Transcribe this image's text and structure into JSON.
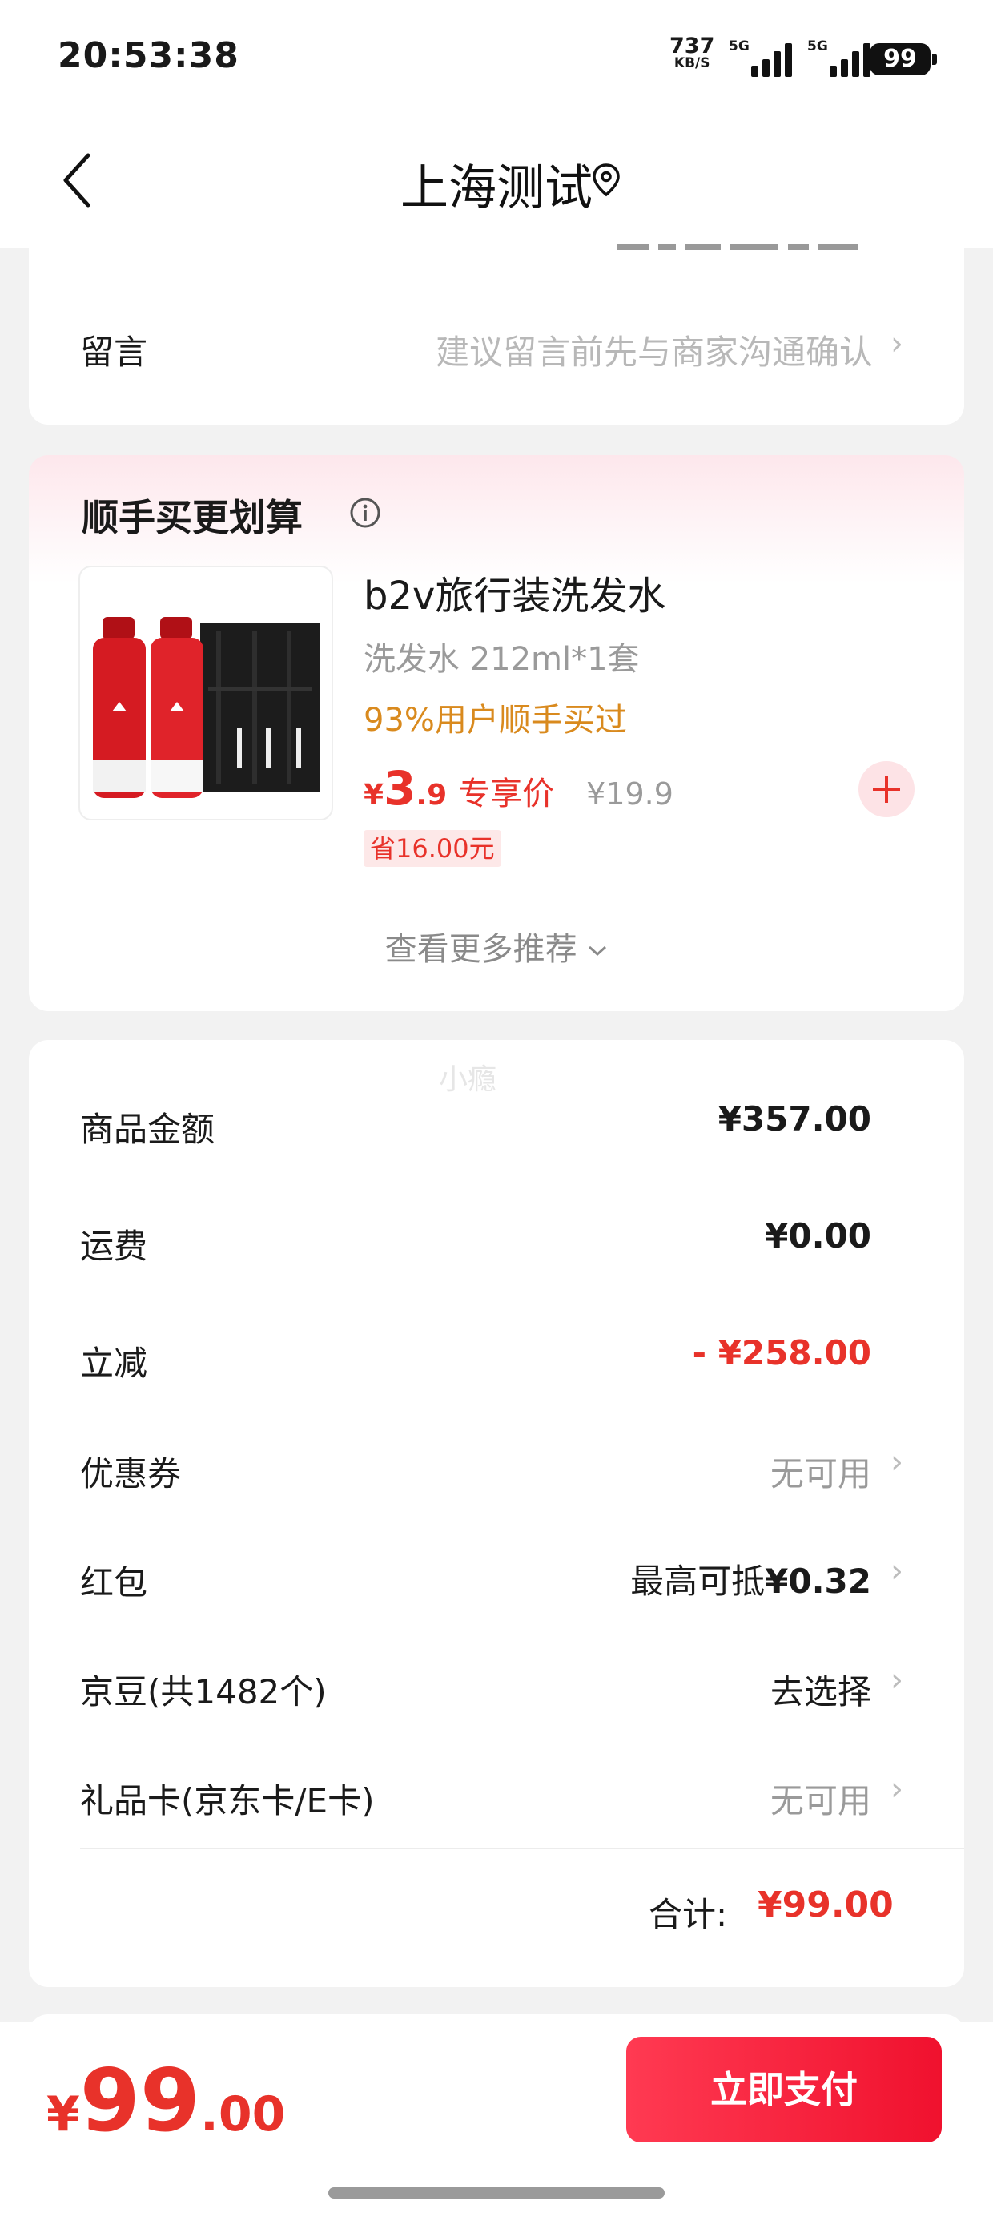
{
  "status_bar": {
    "time": "20:53:38",
    "net_speed": "737",
    "net_unit": "KB/S",
    "signal1": "5G",
    "signal2": "5G",
    "battery": "99"
  },
  "nav": {
    "title": "上海测试"
  },
  "message_row": {
    "label": "留言",
    "placeholder": "建议留言前先与商家沟通确认"
  },
  "recommend": {
    "title": "顺手买更划算",
    "product": {
      "name": "b2v旅行装洗发水",
      "spec": "洗发水 212ml*1套",
      "percent_text": "93%用户顺手买过",
      "price_symbol": "¥",
      "price_int": "3",
      "price_dec": ".9",
      "price_tag": "专享价",
      "original_price": "¥19.9",
      "save_badge": "省16.00元"
    },
    "more_label": "查看更多推荐"
  },
  "summary": {
    "watermark": "小瘾",
    "rows": [
      {
        "label": "商品金额",
        "value": "¥357.00"
      },
      {
        "label": "运费",
        "value": "¥0.00"
      },
      {
        "label": "立减",
        "value": "- ¥258.00"
      },
      {
        "label": "优惠券",
        "value": "无可用"
      },
      {
        "label": "红包",
        "value": "最高可抵",
        "value_strong": "¥0.32"
      },
      {
        "label": "京豆(共1482个)",
        "value": "去选择"
      },
      {
        "label": "礼品卡(京东卡/E卡)",
        "value": "无可用"
      }
    ],
    "total_label": "合计:",
    "total_value": "¥99.00"
  },
  "bottom_bar": {
    "currency": "¥",
    "amount_int": "99",
    "amount_dec": ".00",
    "pay_button": "立即支付"
  },
  "colors": {
    "accent_red": "#e8322a",
    "pay_button": "#f0112e",
    "orange": "#d98a1e"
  }
}
